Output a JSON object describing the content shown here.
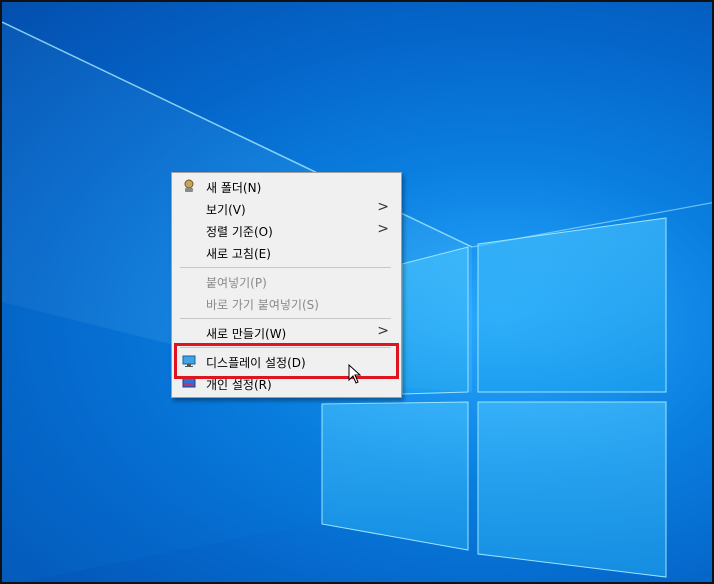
{
  "menu": {
    "new_folder": "새 폴더(N)",
    "view": "보기(V)",
    "sort_by": "정렬 기준(O)",
    "refresh": "새로 고침(E)",
    "paste": "붙여넣기(P)",
    "paste_shortcut": "바로 가기 붙여넣기(S)",
    "new": "새로 만들기(W)",
    "display_settings": "디스플레이 설정(D)",
    "personalize": "개인 설정(R)",
    "submenu_arrow": ">"
  },
  "colors": {
    "highlight": "#e0141e",
    "menu_bg": "#f0f0f0",
    "desktop": "#0a7fe0"
  }
}
